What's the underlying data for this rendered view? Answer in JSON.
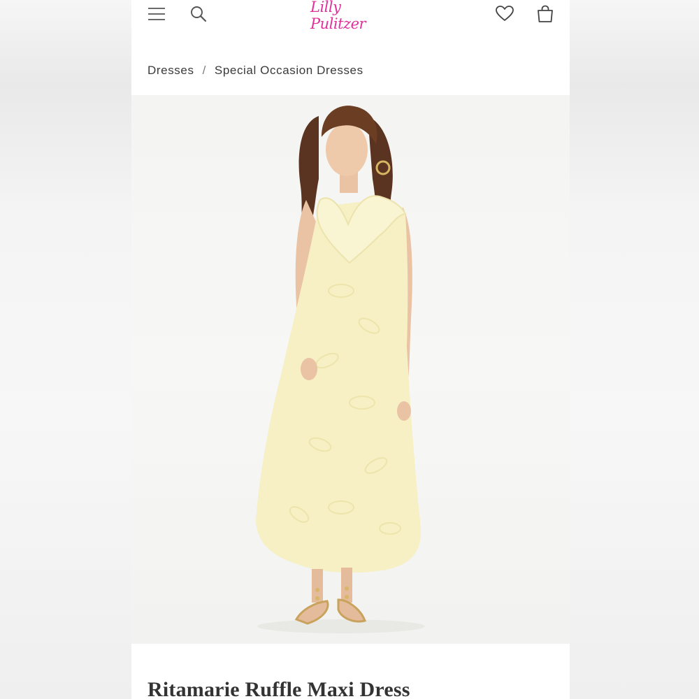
{
  "brand": {
    "logo_text": "Lilly Pulitzer",
    "logo_color": "#e1309a"
  },
  "header": {
    "menu_icon": "hamburger-menu-icon",
    "search_icon": "search-icon",
    "wishlist_icon": "heart-icon",
    "bag_icon": "shopping-bag-icon"
  },
  "breadcrumb": {
    "items": [
      "Dresses",
      "Special Occasion Dresses"
    ],
    "separator": "/"
  },
  "product": {
    "image_alt": "Model wearing a pale yellow lace maxi dress with ruffled V-neckline and gold sandals",
    "dress_color": "#f6f0c4",
    "title": "Ritamarie Ruffle Maxi Dress"
  }
}
